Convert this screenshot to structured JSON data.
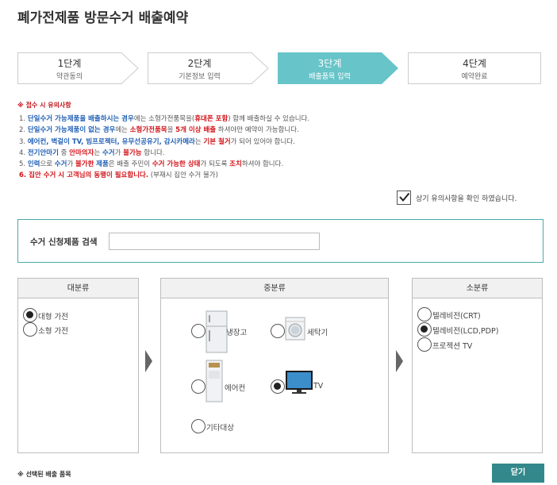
{
  "page": {
    "title": "폐가전제품 방문수거 배출예약"
  },
  "steps": [
    {
      "title": "1단계",
      "sub": "약관동의",
      "active": false
    },
    {
      "title": "2단계",
      "sub": "기본정보 입력",
      "active": false
    },
    {
      "title": "3단계",
      "sub": "배출품목 입력",
      "active": true
    },
    {
      "title": "4단계",
      "sub": "예약완료",
      "active": false
    }
  ],
  "notice": {
    "title": "※ 접수 시 유의사항",
    "items": [
      [
        {
          "t": "1. "
        },
        {
          "t": "단일수거 가능제품을 배출하시는 경우",
          "c": "blue"
        },
        {
          "t": "에는 소형가전품목을("
        },
        {
          "t": "휴대폰 포함",
          "c": "red"
        },
        {
          "t": ") 함께 배출하실 수 있습니다."
        }
      ],
      [
        {
          "t": "2. "
        },
        {
          "t": "단일수거 가능제품이 없는 경우",
          "c": "blue"
        },
        {
          "t": "에는 "
        },
        {
          "t": "소형가전품목",
          "c": "red"
        },
        {
          "t": "을 "
        },
        {
          "t": "5개 이상 배출",
          "c": "red"
        },
        {
          "t": " 하셔야만 예약이 가능합니다."
        }
      ],
      [
        {
          "t": "3. "
        },
        {
          "t": "에어컨, 벽걸이 TV, 빔프로젝터, 유무선공유기, 감시카메라",
          "c": "blue"
        },
        {
          "t": "는 "
        },
        {
          "t": "기본 철거",
          "c": "red"
        },
        {
          "t": "가 되어 있어야 합니다."
        }
      ],
      [
        {
          "t": "4. "
        },
        {
          "t": "전기안마기",
          "c": "blue"
        },
        {
          "t": " 중 "
        },
        {
          "t": "안마의자",
          "c": "red"
        },
        {
          "t": "는 "
        },
        {
          "t": "수거",
          "c": "blue"
        },
        {
          "t": "가 "
        },
        {
          "t": "불가능",
          "c": "red"
        },
        {
          "t": " 합니다."
        }
      ],
      [
        {
          "t": "5. "
        },
        {
          "t": "인력",
          "c": "blue"
        },
        {
          "t": "으로 "
        },
        {
          "t": "수거",
          "c": "blue"
        },
        {
          "t": "가 "
        },
        {
          "t": "불가한",
          "c": "red"
        },
        {
          "t": " "
        },
        {
          "t": "제품",
          "c": "blue"
        },
        {
          "t": "은 배출 주민이 "
        },
        {
          "t": "수거 가능한 상태",
          "c": "red"
        },
        {
          "t": "가 되도록 "
        },
        {
          "t": "조치",
          "c": "red"
        },
        {
          "t": "하셔야 합니다."
        }
      ],
      [
        {
          "t": "6. 집안 수거 시 고객님의 동행이 필요합니다.",
          "c": "red"
        },
        {
          "t": " (부재시 집안 수거 불가)"
        }
      ]
    ]
  },
  "confirm": {
    "label": "상기 유의사항을 확인 하였습니다.",
    "checked": true
  },
  "search": {
    "label": "수거 신청제품 검색",
    "value": "",
    "placeholder": ""
  },
  "categories": {
    "large": {
      "header": "대분류",
      "options": [
        {
          "label": "대형 가전",
          "checked": true
        },
        {
          "label": "소형 가전",
          "checked": false
        }
      ]
    },
    "mid": {
      "header": "중분류",
      "options": [
        {
          "label": "냉장고",
          "checked": false,
          "icon": "refrigerator-icon"
        },
        {
          "label": "세탁기",
          "checked": false,
          "icon": "washing-machine-icon"
        },
        {
          "label": "에어컨",
          "checked": false,
          "icon": "air-conditioner-icon"
        },
        {
          "label": "TV",
          "checked": true,
          "icon": "tv-icon"
        },
        {
          "label": "기타대상",
          "checked": false,
          "icon": ""
        }
      ]
    },
    "small": {
      "header": "소분류",
      "options": [
        {
          "label": "텔레비전(CRT)",
          "checked": false
        },
        {
          "label": "텔레비전(LCD,PDP)",
          "checked": true
        },
        {
          "label": "프로젝션 TV",
          "checked": false
        }
      ]
    }
  },
  "footer": {
    "selected_label": "※ 선택된 배출 품목",
    "close_label": "닫기"
  },
  "colors": {
    "step_active": "#67c4c8",
    "accent": "#33888b",
    "red": "#d2141a",
    "blue": "#1f5fb5"
  }
}
